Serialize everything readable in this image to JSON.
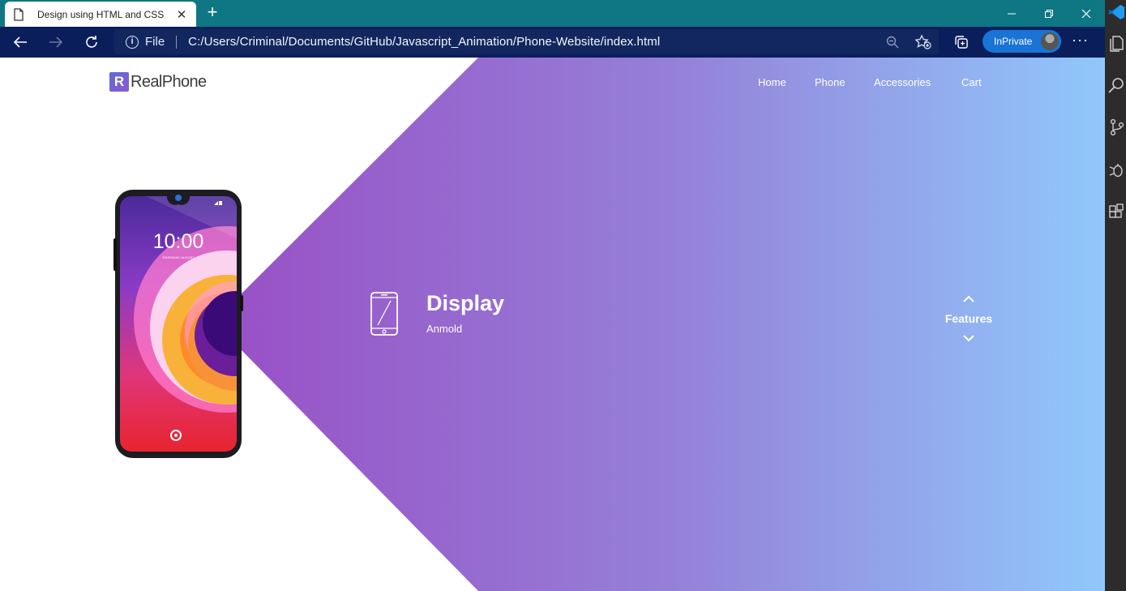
{
  "browser": {
    "tab_title": "Design using HTML and CSS",
    "tab_close": "✕",
    "new_tab": "+",
    "file_label": "File",
    "url": "C:/Users/Criminal/Documents/GitHub/Javascript_Animation/Phone-Website/index.html",
    "inprivate_label": "InPrivate",
    "more": "···",
    "tab_color": "#0f7784",
    "toolbar_color": "#0b1e5c",
    "inprivate_color": "#1a74d6"
  },
  "site": {
    "logo_mark": "R",
    "logo_text": "RealPhone",
    "nav": [
      "Home",
      "Phone",
      "Accessories",
      "Cart"
    ],
    "phone_time": "10:00",
    "phone_date": "THURSDAY, AUGUST",
    "feature": {
      "title": "Display",
      "subtitle": "Anmold",
      "icon": "smartphone-icon"
    },
    "features_label": "Features",
    "gradient": [
      "#9955c6",
      "#92c6fb"
    ]
  }
}
